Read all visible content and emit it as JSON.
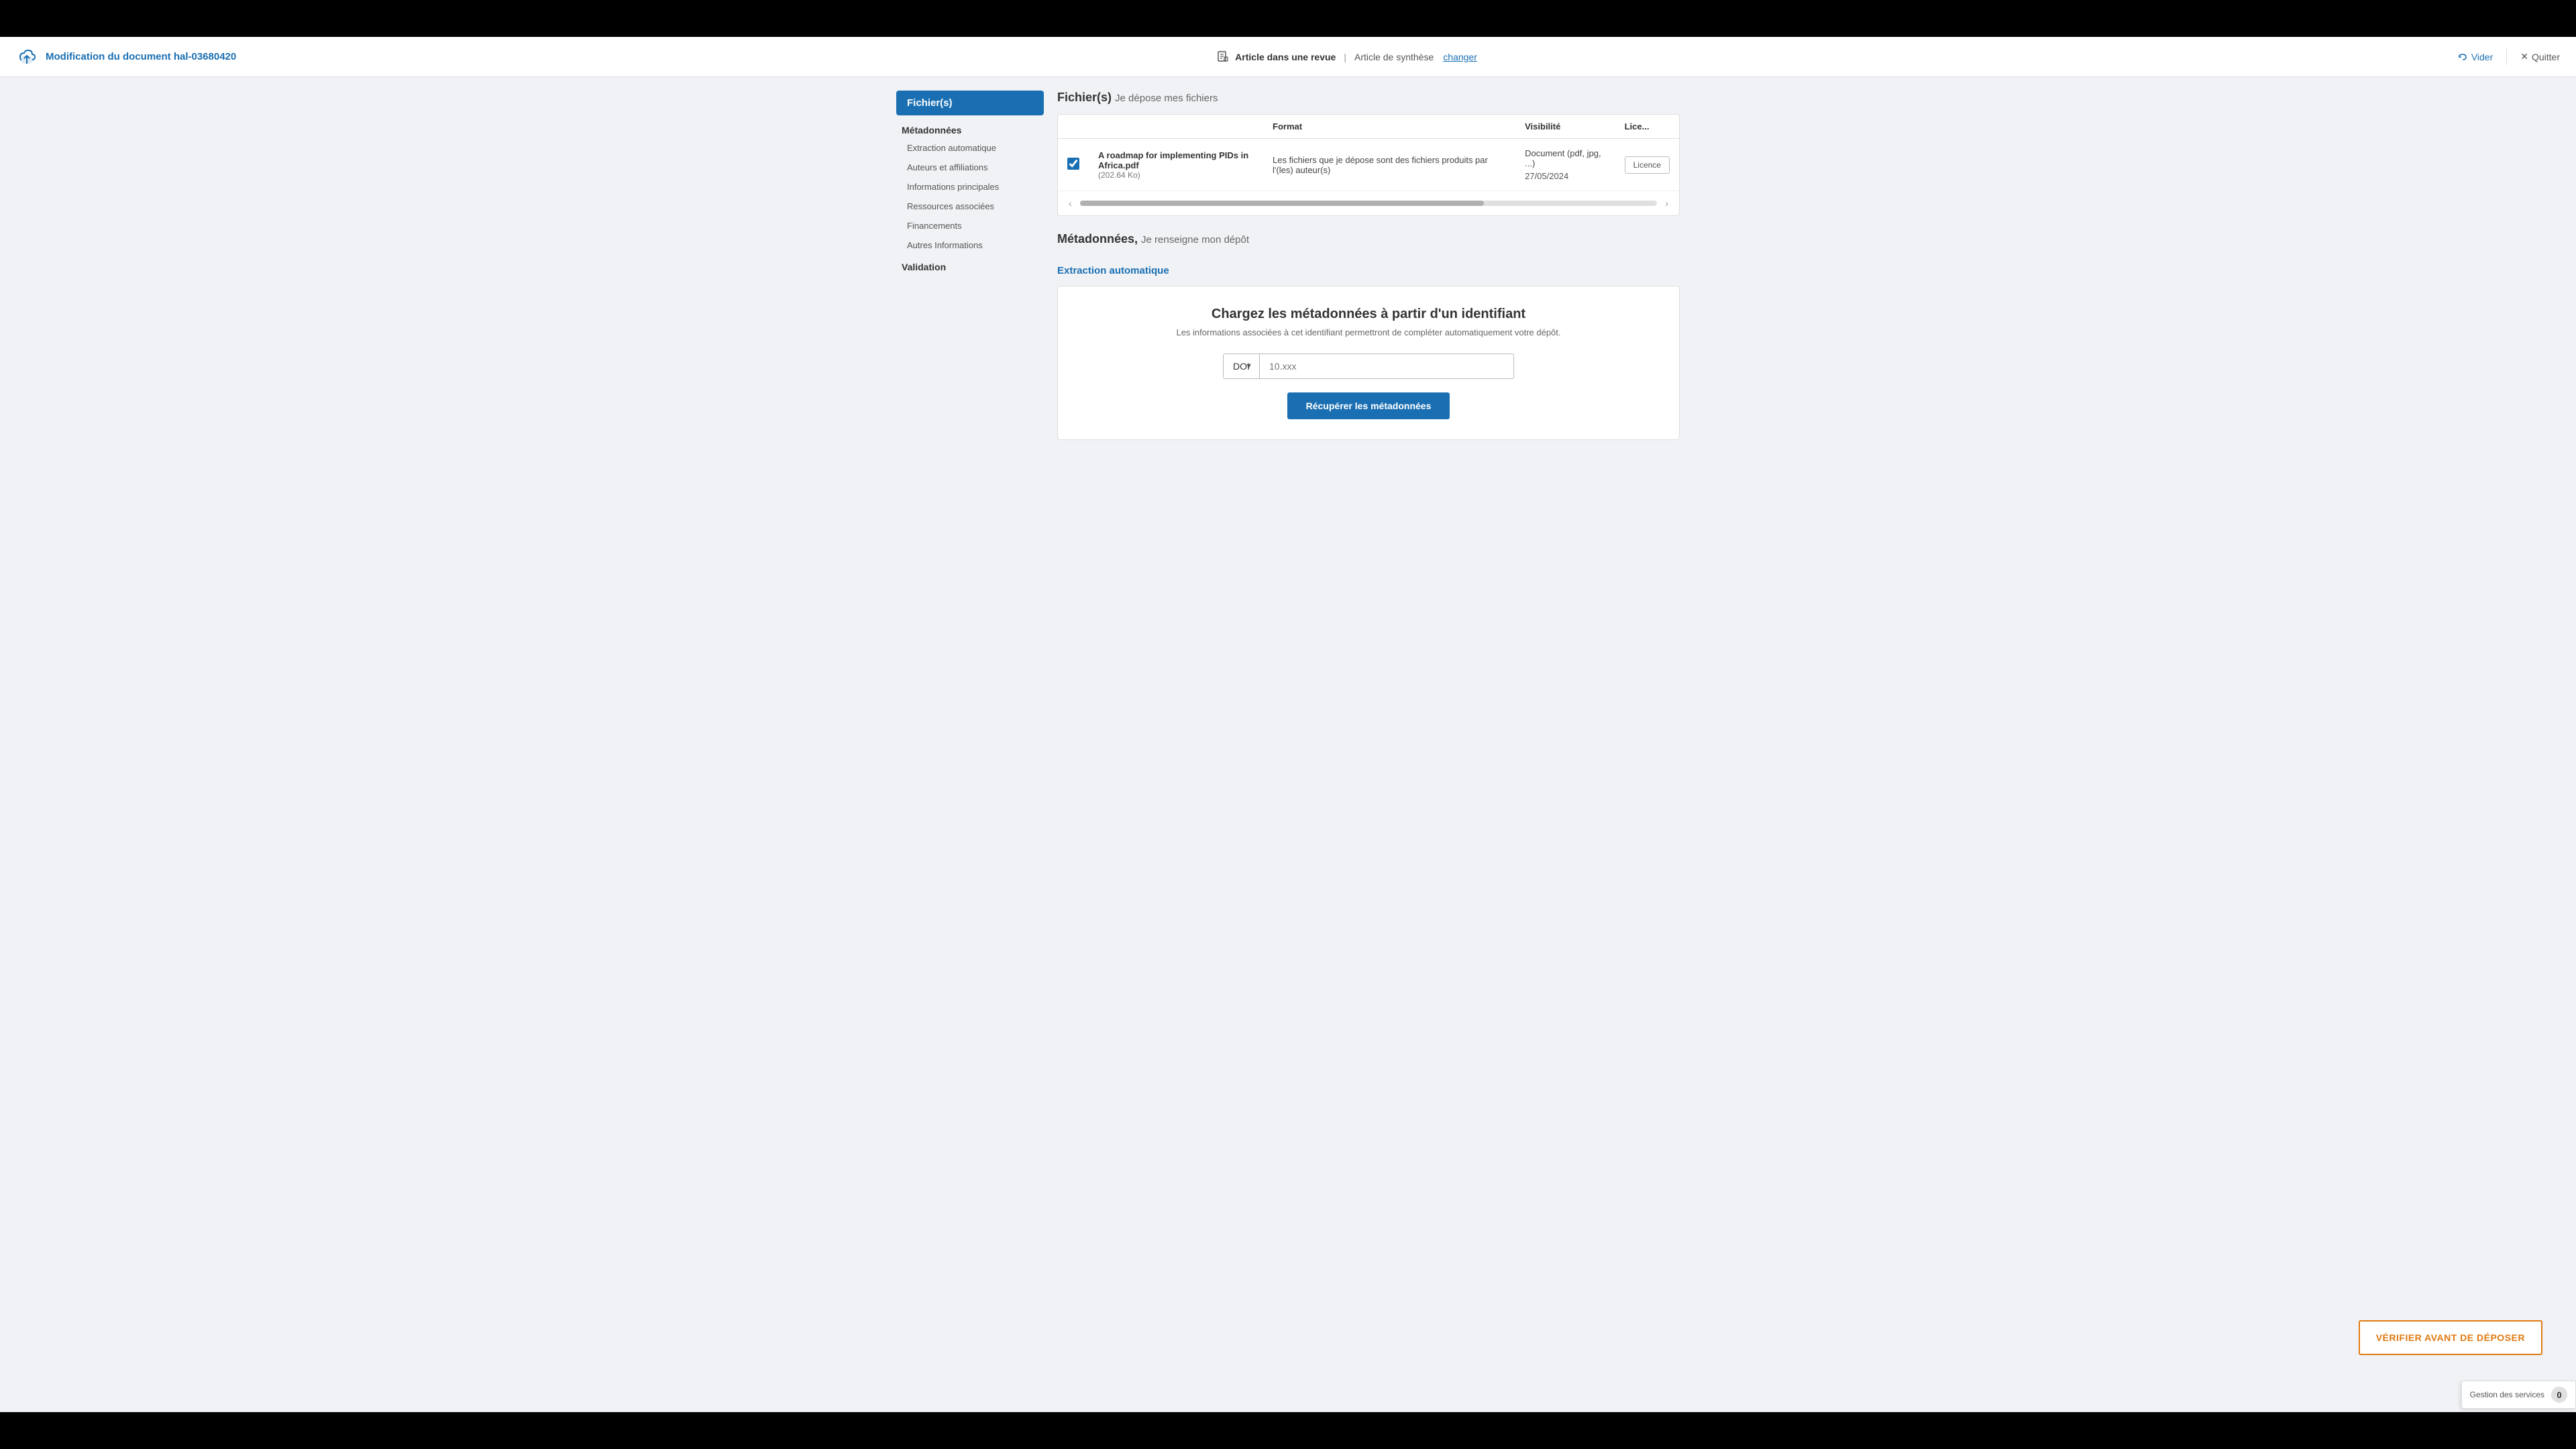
{
  "topBar": {
    "visible": true
  },
  "header": {
    "title": "Modification du document hal-03680420",
    "docType": "Article dans une revue",
    "separator": "|",
    "subType": "Article de synthèse",
    "changerLabel": "changer",
    "viderLabel": "Vider",
    "quitterLabel": "Quitter"
  },
  "sidebar": {
    "activeSection": "Fichier(s)",
    "metadonneesLabel": "Métadonnées",
    "items": [
      {
        "label": "Extraction automatique"
      },
      {
        "label": "Auteurs et affiliations"
      },
      {
        "label": "Informations principales"
      },
      {
        "label": "Ressources associées"
      },
      {
        "label": "Financements"
      },
      {
        "label": "Autres Informations"
      }
    ],
    "validationLabel": "Validation"
  },
  "filesSection": {
    "title": "Fichier(s)",
    "subtitle": "Je dépose mes fichiers",
    "table": {
      "columns": [
        "Format",
        "Visibilité",
        "Lice..."
      ],
      "file": {
        "name": "A roadmap for implementing PIDs in Africa.pdf",
        "size": "(202.64 Ko)",
        "description": "Les fichiers que je dépose sont des fichiers produits par l'(les) auteur(s)",
        "format": "Document (pdf, jpg, ...)",
        "date": "27/05/2024",
        "licenseBtn": "Licence"
      }
    }
  },
  "metadataSection": {
    "title": "Métadonnées,",
    "subtitle": "Je renseigne mon dépôt",
    "extractionLink": "Extraction automatique",
    "cardTitle": "Chargez les métadonnées à partir d'un identifiant",
    "cardSubtitle": "Les informations associées à cet identifiant permettront de compléter automatiquement votre dépôt.",
    "doiLabel": "DOI",
    "doiPlaceholder": "10.xxx",
    "recupererLabel": "Récupérer les métadonnées"
  },
  "verifierBtn": "VÉRIFIER AVANT DE DÉPOSER",
  "gestionLabel": "Gestion des services",
  "gestionCount": "0"
}
